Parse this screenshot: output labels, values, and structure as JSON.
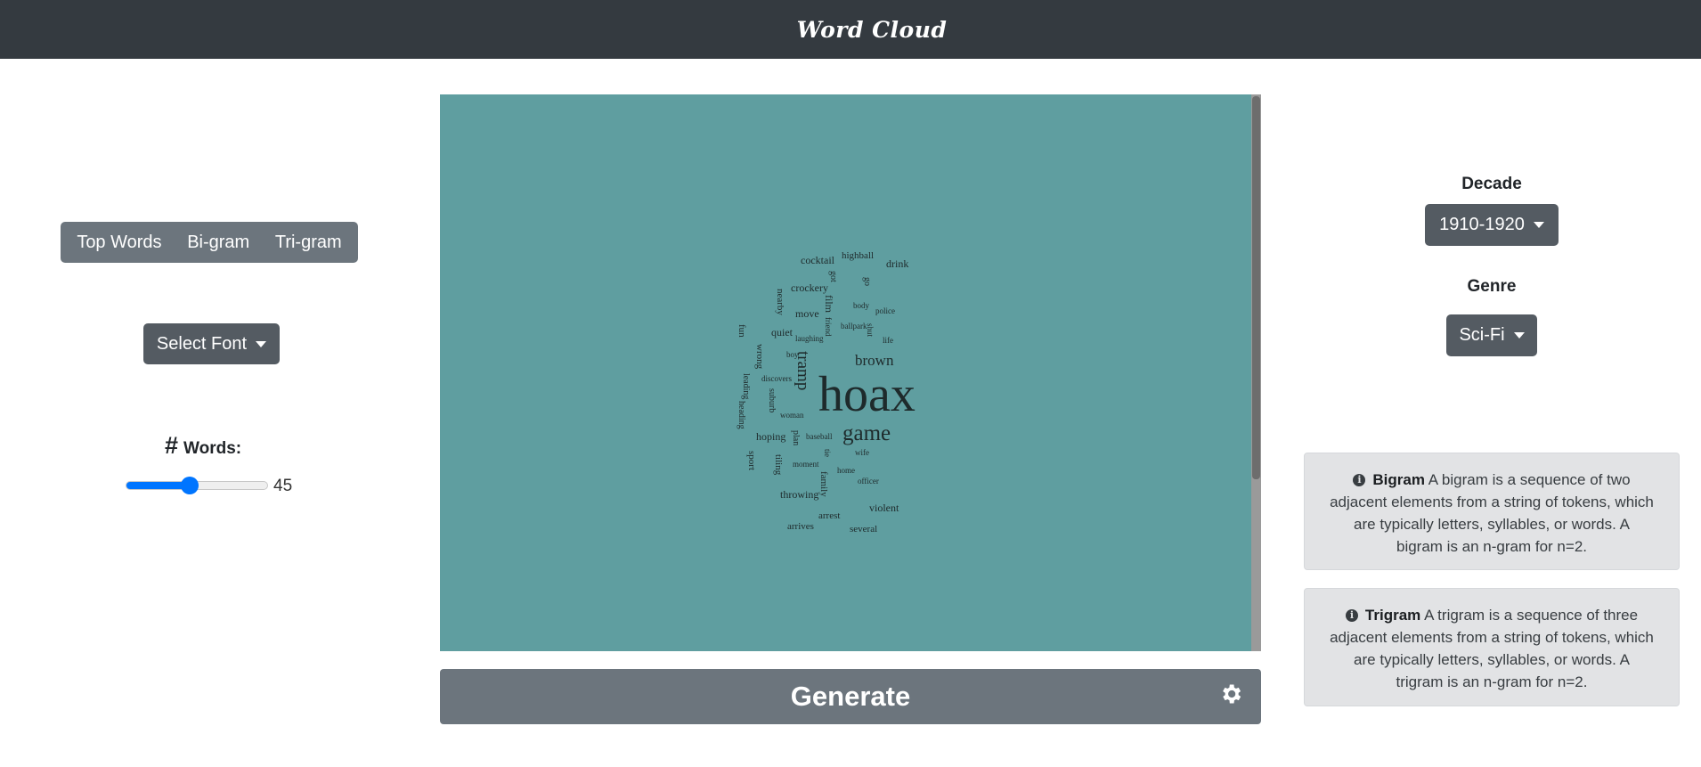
{
  "header": {
    "title": "Word Cloud"
  },
  "ngram_tabs": [
    "Top Words",
    "Bi-gram",
    "Tri-gram"
  ],
  "font_dropdown": {
    "label": "Select Font"
  },
  "word_count": {
    "hash": "#",
    "label": "Words:",
    "value": "45",
    "fraction": 0.45
  },
  "decade": {
    "label": "Decade",
    "selected": "1910-1920"
  },
  "genre": {
    "label": "Genre",
    "selected": "Sci-Fi"
  },
  "generate": {
    "label": "Generate"
  },
  "info": {
    "bigram": {
      "term": "Bigram",
      "text": "A bigram is a sequence of two adjacent elements from a string of tokens, which are typically letters, syllables, or words. A bigram is an n-gram for n=2."
    },
    "trigram": {
      "term": "Trigram",
      "text": "A trigram is a sequence of three adjacent elements from a string of tokens, which are typically letters, syllables, or words. A trigram is an n-gram for n=2."
    }
  },
  "colors": {
    "navbar": "#343a40",
    "canvas": "#5f9ea0",
    "button": "#6c757d",
    "slider": "#0075ff",
    "info_bg": "#e2e3e5"
  },
  "word_cloud": {
    "words": [
      "cocktail",
      "highball",
      "drink",
      "got",
      "go",
      "crockery",
      "nearby",
      "film",
      "body",
      "police",
      "move",
      "friend",
      "ballpark",
      "shut",
      "life",
      "fun",
      "quiet",
      "laughing",
      "boy",
      "wrong",
      "brown",
      "tramp",
      "discovers",
      "leading",
      "suburb",
      "hoax",
      "woman",
      "heading",
      "hoping",
      "plan",
      "baseball",
      "game",
      "sport",
      "tiling",
      "tie",
      "wife",
      "moment",
      "home",
      "family",
      "officer",
      "throwing",
      "violent",
      "arrest",
      "arrives",
      "several"
    ]
  }
}
